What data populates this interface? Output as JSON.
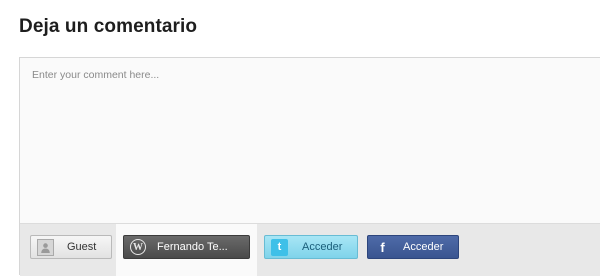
{
  "heading": "Deja un comentario",
  "comment": {
    "placeholder": "Enter your comment here...",
    "value": ""
  },
  "login_options": {
    "guest": {
      "label": "Guest",
      "icon": "user-silhouette-icon"
    },
    "wordpress": {
      "label": "Fernando Te...",
      "icon": "wordpress-logo-icon",
      "glyph": "W"
    },
    "twitter": {
      "label": "Acceder",
      "icon": "twitter-logo-icon",
      "glyph": "t"
    },
    "facebook": {
      "label": "Acceder",
      "icon": "facebook-logo-icon",
      "glyph": "f"
    }
  },
  "colors": {
    "twitter": "#7fd3ea",
    "facebook": "#3a5590",
    "wordpress_active": "#4a4a4a"
  }
}
